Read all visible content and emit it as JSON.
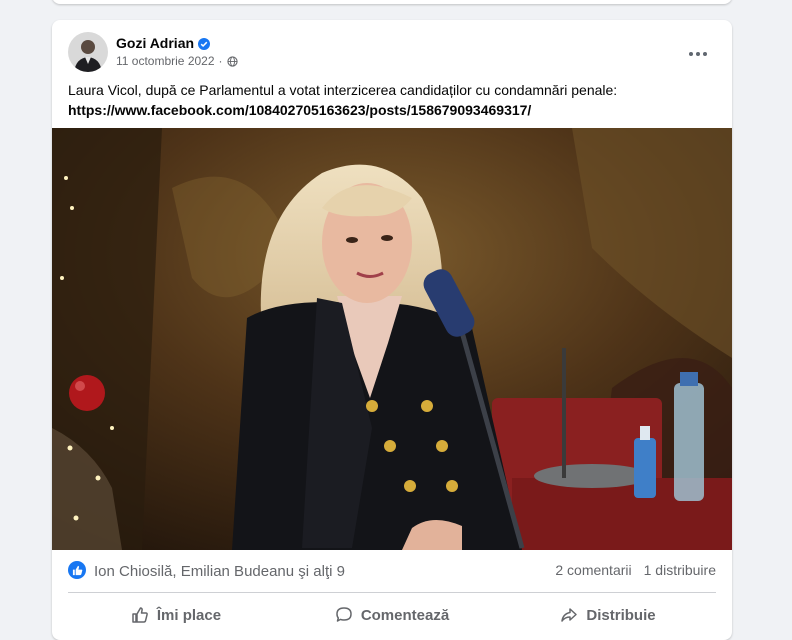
{
  "post": {
    "author": "Gozi Adrian",
    "date": "11 octombrie 2022",
    "separator": "·",
    "text": "Laura Vicol, după ce Parlamentul a votat interzicerea candidaților cu condamnări penale:",
    "link": "https://www.facebook.com/108402705163623/posts/158679093469317/",
    "icons": [
      "verified-badge-icon",
      "globe-icon",
      "more-options-icon"
    ]
  },
  "stats": {
    "reactors": "Ion Chiosilă, Emilian Budeanu şi alţi 9",
    "comments": "2 comentarii",
    "shares": "1 distribuire"
  },
  "actions": {
    "like": "Îmi place",
    "comment": "Comentează",
    "share": "Distribuie"
  },
  "colors": {
    "accent": "#1877f2",
    "background": "#f0f2f5",
    "secondary_text": "#65676b"
  }
}
